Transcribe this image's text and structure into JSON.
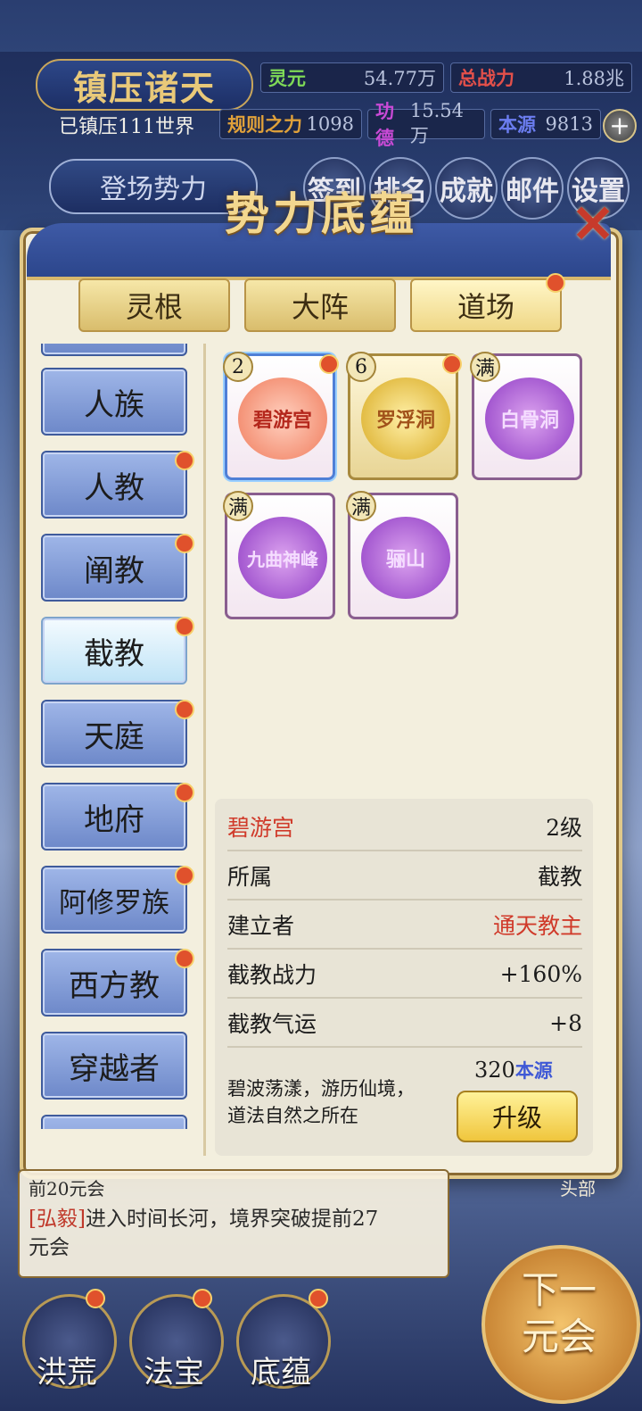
{
  "hud": {
    "title": "镇压诸天",
    "world_status": "已镇压111世界",
    "stats": [
      {
        "label": "灵元",
        "value": "54.77万",
        "label_color": "#7ed957"
      },
      {
        "label": "总战力",
        "value": "1.88兆",
        "label_color": "#e3504a"
      },
      {
        "label": "规则之力",
        "value": "1098",
        "label_color": "#e0a13a"
      },
      {
        "label": "功德",
        "value": "15.54万",
        "label_color": "#c94ad6"
      },
      {
        "label": "本源",
        "value": "9813",
        "label_color": "#6b7df0"
      }
    ],
    "plus": "+",
    "enter_button": "登场势力",
    "nav": [
      "签到",
      "排名",
      "成就",
      "邮件",
      "设置"
    ]
  },
  "modal": {
    "title": "势力底蕴",
    "close": "✕",
    "tabs": [
      "灵根",
      "大阵",
      "道场"
    ],
    "factions": [
      "人族",
      "人教",
      "阐教",
      "截教",
      "天庭",
      "地府",
      "阿修罗族",
      "西方教",
      "穿越者"
    ],
    "cards": [
      {
        "name": "碧游宫",
        "badge": "2"
      },
      {
        "name": "罗浮洞",
        "badge": "6"
      },
      {
        "name": "白骨洞",
        "badge": "满"
      },
      {
        "name": "九曲神峰",
        "badge": "满"
      },
      {
        "name": "骊山",
        "badge": "满"
      }
    ],
    "info": {
      "name": "碧游宫",
      "level": "2级",
      "rows": [
        {
          "label": "所属",
          "value": "截教"
        },
        {
          "label": "建立者",
          "value": "通天教主"
        },
        {
          "label": "截教战力",
          "value": "+160%"
        },
        {
          "label": "截教气运",
          "value": "+8"
        }
      ],
      "desc_line1": "碧波荡漾，游历仙境，",
      "desc_line2": "道法自然之所在",
      "cost_amount": "320",
      "cost_unit": "本源",
      "upgrade": "升级"
    }
  },
  "log": {
    "top_fragment": "前20元会",
    "line1_name": "[弘毅]",
    "line1_text": "进入时间长河，境界突破提前27",
    "line2_text": "元会",
    "right_fragment": "头部"
  },
  "bottom": {
    "buttons": [
      "洪荒",
      "法宝",
      "底蕴"
    ],
    "next_line1": "下一",
    "next_line2": "元会"
  }
}
